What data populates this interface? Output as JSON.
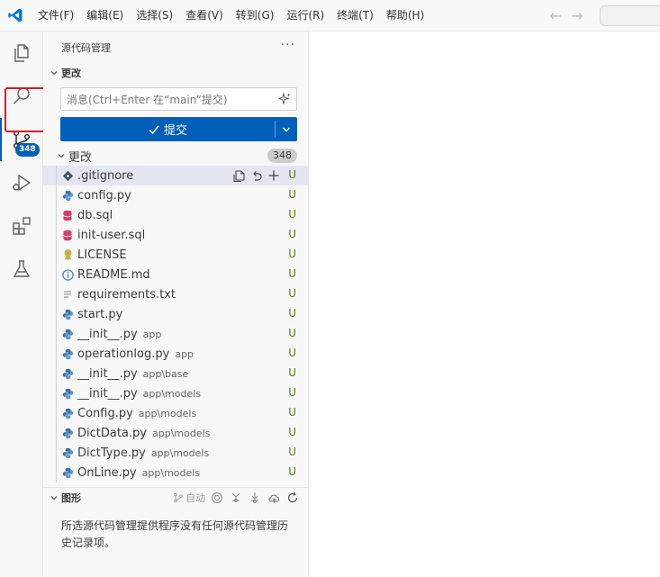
{
  "menu": [
    "文件(F)",
    "编辑(E)",
    "选择(S)",
    "查看(V)",
    "转到(G)",
    "运行(R)",
    "终端(T)",
    "帮助(H)"
  ],
  "activity_bar": {
    "items": [
      {
        "name": "explorer",
        "icon": "files-icon"
      },
      {
        "name": "search",
        "icon": "search-icon"
      },
      {
        "name": "source-control",
        "icon": "source-control-icon",
        "badge": "348",
        "active": true
      },
      {
        "name": "run-debug",
        "icon": "run-debug-icon"
      },
      {
        "name": "extensions",
        "icon": "extensions-icon"
      },
      {
        "name": "testing",
        "icon": "flask-icon"
      }
    ]
  },
  "sidebar": {
    "title": "源代码管理",
    "changes_section": "更改",
    "message_placeholder": "消息(Ctrl+Enter 在“main”提交)",
    "commit_label": "提交",
    "changes_group": {
      "label": "更改",
      "count": "348"
    },
    "files": [
      {
        "name": ".gitignore",
        "dir": "",
        "status": "U",
        "icon": "gitignore-icon",
        "icon_color": "#41535b"
      },
      {
        "name": "config.py",
        "dir": "",
        "status": "U",
        "icon": "python-icon",
        "icon_color": "#3572a5"
      },
      {
        "name": "db.sql",
        "dir": "",
        "status": "U",
        "icon": "database-icon",
        "icon_color": "#d03f6c"
      },
      {
        "name": "init-user.sql",
        "dir": "",
        "status": "U",
        "icon": "database-icon",
        "icon_color": "#d03f6c"
      },
      {
        "name": "LICENSE",
        "dir": "",
        "status": "U",
        "icon": "license-icon",
        "icon_color": "#cbb04a"
      },
      {
        "name": "README.md",
        "dir": "",
        "status": "U",
        "icon": "info-icon",
        "icon_color": "#4a7fb5"
      },
      {
        "name": "requirements.txt",
        "dir": "",
        "status": "U",
        "icon": "text-file-icon",
        "icon_color": "#9a9a9a"
      },
      {
        "name": "start.py",
        "dir": "",
        "status": "U",
        "icon": "python-icon",
        "icon_color": "#3572a5"
      },
      {
        "name": "__init__.py",
        "dir": "app",
        "status": "U",
        "icon": "python-icon",
        "icon_color": "#3572a5"
      },
      {
        "name": "operationlog.py",
        "dir": "app",
        "status": "U",
        "icon": "python-icon",
        "icon_color": "#3572a5"
      },
      {
        "name": "__init__.py",
        "dir": "app\\base",
        "status": "U",
        "icon": "python-icon",
        "icon_color": "#3572a5"
      },
      {
        "name": "__init__.py",
        "dir": "app\\models",
        "status": "U",
        "icon": "python-icon",
        "icon_color": "#3572a5"
      },
      {
        "name": "Config.py",
        "dir": "app\\models",
        "status": "U",
        "icon": "python-icon",
        "icon_color": "#3572a5"
      },
      {
        "name": "DictData.py",
        "dir": "app\\models",
        "status": "U",
        "icon": "python-icon",
        "icon_color": "#3572a5"
      },
      {
        "name": "DictType.py",
        "dir": "app\\models",
        "status": "U",
        "icon": "python-icon",
        "icon_color": "#3572a5"
      },
      {
        "name": "OnLine.py",
        "dir": "app\\models",
        "status": "U",
        "icon": "python-icon",
        "icon_color": "#3572a5"
      }
    ],
    "graph": {
      "title": "图形",
      "auto_label": "自动",
      "message": "所选源代码管理提供程序没有任何源代码管理历史记录项。"
    }
  },
  "colors": {
    "accent": "#005fb8",
    "untracked_status": "#587c0c",
    "highlight_box": "#e3171e"
  }
}
